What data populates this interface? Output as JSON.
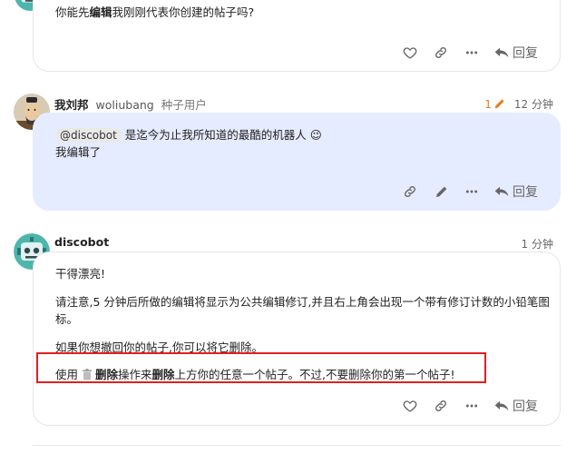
{
  "post1": {
    "text_prefix": "你能先",
    "text_bold": "编辑",
    "text_suffix": "我刚刚代表你创建的帖子吗?",
    "reply_label": "回复"
  },
  "post2": {
    "display_name": "我刘邦",
    "username": "woliubang",
    "user_title": "种子用户",
    "edit_count": "1",
    "time": "12 分钟",
    "mention": "@discobot",
    "line1": "是迄今为止我所知道的最酷的机器人",
    "emoji": "😉",
    "line2": "我编辑了",
    "reply_label": "回复"
  },
  "post3": {
    "display_name": "discobot",
    "time": "1 分钟",
    "para1": "干得漂亮!",
    "para2": "请注意,5 分钟后所做的编辑将显示为公共编辑修订,并且右上角会出现一个带有修订计数的小铅笔图标。",
    "para3": "如果你想撤回你的帖子,你可以将它删除。",
    "para4_a": "使用 ",
    "para4_b": "删除",
    "para4_c": "操作来",
    "para4_d": "删除",
    "para4_e": "上方你的任意一个帖子。不过,不要删除你的第一个帖子!",
    "reply_label": "回复"
  },
  "colors": {
    "highlight_bg": "#e6ecff",
    "edit_orange": "#e67e22",
    "callout_red": "#e02020"
  }
}
